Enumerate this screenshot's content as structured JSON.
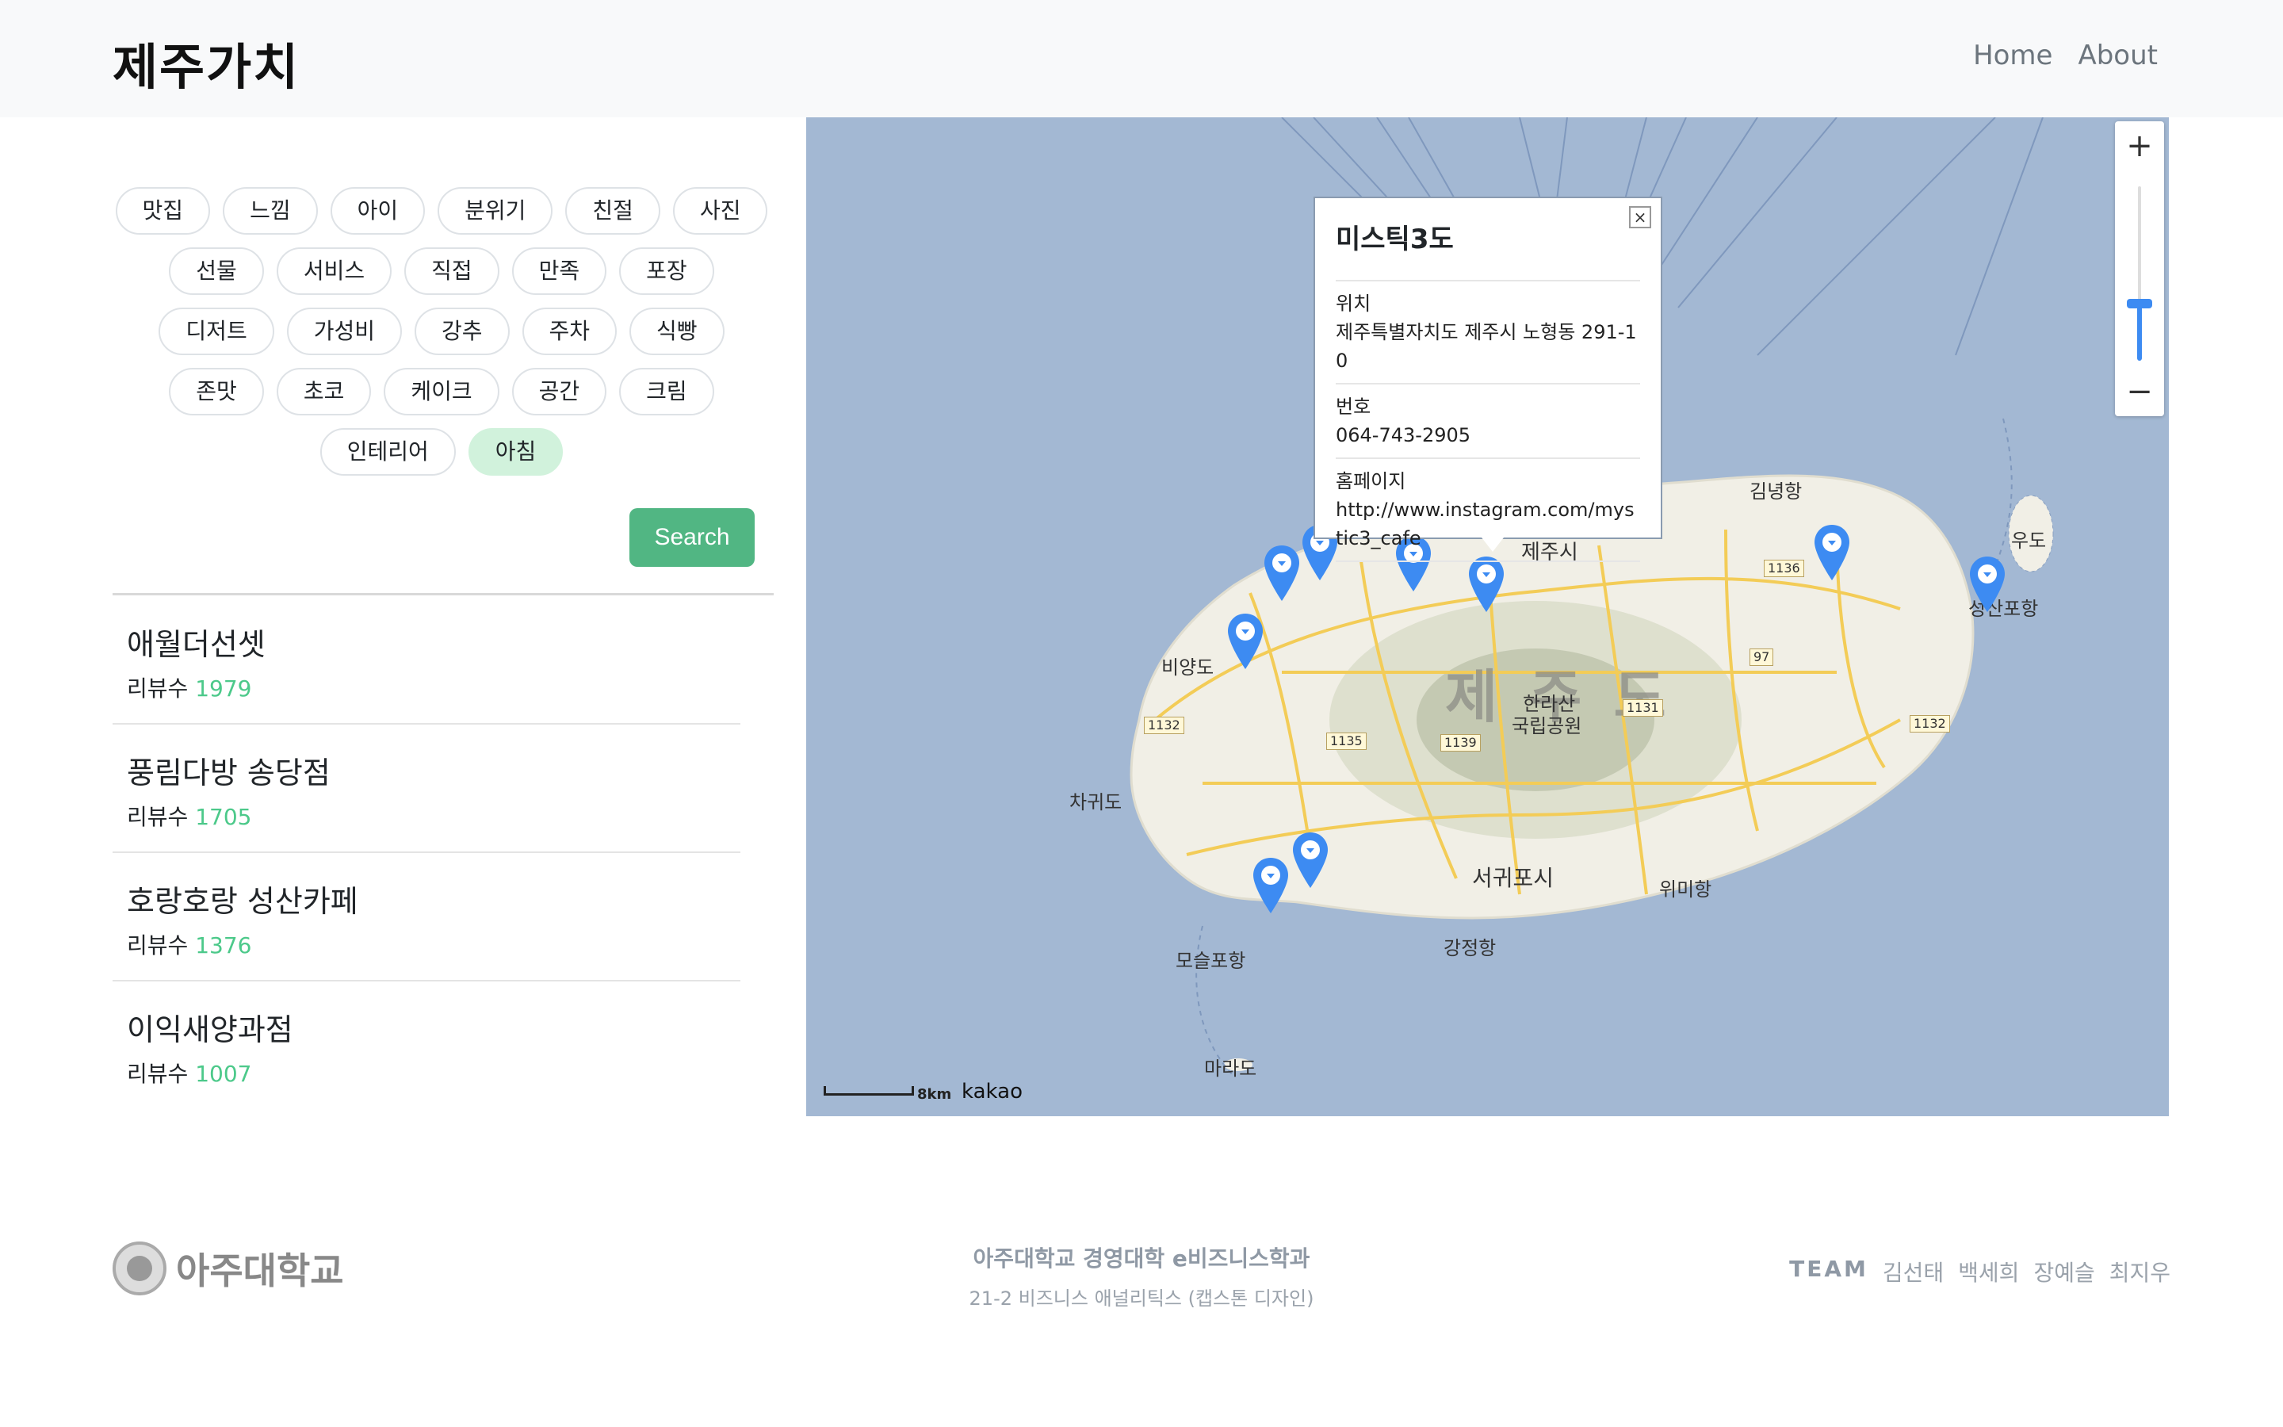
{
  "header": {
    "brand": "제주가치",
    "nav": [
      {
        "label": "Home"
      },
      {
        "label": "About"
      }
    ]
  },
  "tags": {
    "rows": [
      [
        "맛집",
        "느낌",
        "아이",
        "분위기",
        "친절",
        "사진"
      ],
      [
        "선물",
        "서비스",
        "직접",
        "만족",
        "포장"
      ],
      [
        "디저트",
        "가성비",
        "강추",
        "주차",
        "식빵"
      ],
      [
        "존맛",
        "초코",
        "케이크",
        "공간",
        "크림"
      ],
      [
        "인테리어",
        "아침"
      ]
    ],
    "active": "아침"
  },
  "search": {
    "label": "Search"
  },
  "results": [
    {
      "name": "애월더선셋",
      "review_label": "리뷰수",
      "count": "1979"
    },
    {
      "name": "풍림다방 송당점",
      "review_label": "리뷰수",
      "count": "1705"
    },
    {
      "name": "호랑호랑 성산카페",
      "review_label": "리뷰수",
      "count": "1376"
    },
    {
      "name": "이익새양과점",
      "review_label": "리뷰수",
      "count": "1007"
    }
  ],
  "map": {
    "zoom_in": "+",
    "zoom_out": "−",
    "info": {
      "title": "미스틱3도",
      "close": "×",
      "location_label": "위치",
      "location": "제주특별자치도 제주시 노형동 291-10",
      "phone_label": "번호",
      "phone": "064-743-2905",
      "homepage_label": "홈페이지",
      "homepage": "http://www.instagram.com/mystic3_cafe"
    },
    "labels": {
      "jeju_si": "제주시",
      "seogwipo": "서귀포시",
      "island": "제주도",
      "hallasan_1": "한라산",
      "hallasan_2": "국립공원",
      "udo": "우도",
      "seongsanpo": "성산포항",
      "gimnyeong": "김녕항",
      "biyangdo": "비양도",
      "chagwido": "차귀도",
      "moseulpo": "모슬포항",
      "marado": "마라도",
      "gangjeong": "강정항",
      "wimi": "위미항"
    },
    "roads": [
      "1132",
      "1135",
      "1139",
      "1131",
      "1136",
      "97",
      "1132"
    ],
    "scale": "8km",
    "provider": "kakao",
    "colors": {
      "sea": "#a3b8d3",
      "land": "#f1efe6",
      "pin": "#3d8bf2"
    }
  },
  "footer": {
    "university": "아주대학교",
    "dept": "아주대학교 경영대학 e비즈니스학과",
    "course": "21-2 비즈니스 애널리틱스 (캡스톤 디자인)",
    "team_label": "TEAM",
    "members": [
      "김선태",
      "백세희",
      "장예슬",
      "최지우"
    ]
  }
}
